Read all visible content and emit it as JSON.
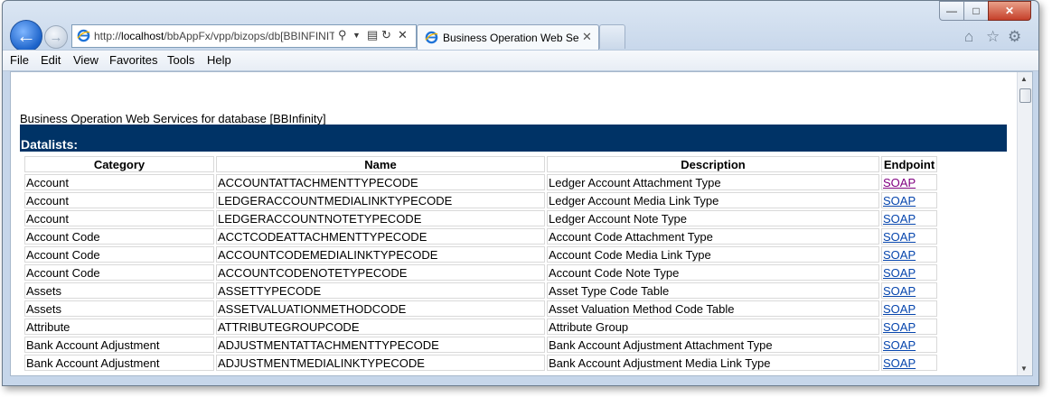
{
  "browser": {
    "address": {
      "prefix": "http://",
      "host": "localhost",
      "path": "/bbAppFx/vpp/bizops/db[BBINFINITY]/default.aspx"
    },
    "tab_title": "Business Operation Web Services for database [BBInfinity]",
    "menu": [
      "File",
      "Edit",
      "View",
      "Favorites",
      "Tools",
      "Help"
    ]
  },
  "page": {
    "heading": "Business Operation Web Services for database [BBInfinity]",
    "section_title": "Datalists:",
    "columns": [
      "Category",
      "Name",
      "Description",
      "Endpoint"
    ],
    "rows": [
      {
        "category": "Account",
        "name": "ACCOUNTATTACHMENTTYPECODE",
        "description": "Ledger Account Attachment Type",
        "endpoint": "SOAP"
      },
      {
        "category": "Account",
        "name": "LEDGERACCOUNTMEDIALINKTYPECODE",
        "description": "Ledger Account Media Link Type",
        "endpoint": "SOAP"
      },
      {
        "category": "Account",
        "name": "LEDGERACCOUNTNOTETYPECODE",
        "description": "Ledger Account Note Type",
        "endpoint": "SOAP"
      },
      {
        "category": "Account Code",
        "name": "ACCTCODEATTACHMENTTYPECODE",
        "description": "Account Code Attachment Type",
        "endpoint": "SOAP"
      },
      {
        "category": "Account Code",
        "name": "ACCOUNTCODEMEDIALINKTYPECODE",
        "description": "Account Code Media Link Type",
        "endpoint": "SOAP"
      },
      {
        "category": "Account Code",
        "name": "ACCOUNTCODENOTETYPECODE",
        "description": "Account Code Note Type",
        "endpoint": "SOAP"
      },
      {
        "category": "Assets",
        "name": "ASSETTYPECODE",
        "description": "Asset Type Code Table",
        "endpoint": "SOAP"
      },
      {
        "category": "Assets",
        "name": "ASSETVALUATIONMETHODCODE",
        "description": "Asset Valuation Method Code Table",
        "endpoint": "SOAP"
      },
      {
        "category": "Attribute",
        "name": "ATTRIBUTEGROUPCODE",
        "description": "Attribute Group",
        "endpoint": "SOAP"
      },
      {
        "category": "Bank Account Adjustment",
        "name": "ADJUSTMENTATTACHMENTTYPECODE",
        "description": "Bank Account Adjustment Attachment Type",
        "endpoint": "SOAP"
      },
      {
        "category": "Bank Account Adjustment",
        "name": "ADJUSTMENTMEDIALINKTYPECODE",
        "description": "Bank Account Adjustment Media Link Type",
        "endpoint": "SOAP"
      }
    ]
  },
  "colors": {
    "banner": "#003366",
    "link": "#0645ad",
    "visited_link": "#800080"
  }
}
